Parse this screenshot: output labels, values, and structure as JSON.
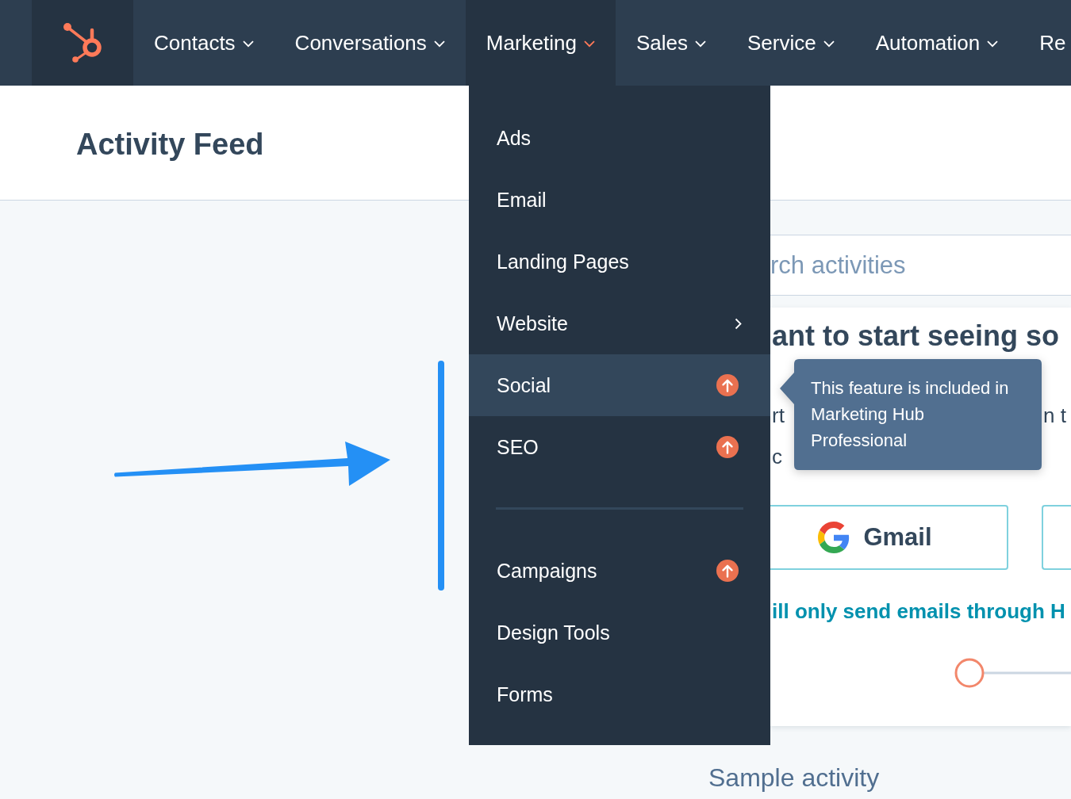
{
  "top_nav": {
    "items": [
      {
        "label": "Contacts",
        "caret": true,
        "selected": false
      },
      {
        "label": "Conversations",
        "caret": true,
        "selected": false
      },
      {
        "label": "Marketing",
        "caret": true,
        "selected": true
      },
      {
        "label": "Sales",
        "caret": true,
        "selected": false
      },
      {
        "label": "Service",
        "caret": true,
        "selected": false
      },
      {
        "label": "Automation",
        "caret": true,
        "selected": false
      },
      {
        "label": "Re",
        "caret": false,
        "selected": false
      }
    ]
  },
  "page_header": {
    "title": "Activity Feed"
  },
  "marketing_menu": {
    "sections": [
      {
        "items": [
          {
            "label": "Ads",
            "kind": "link",
            "selected": false
          },
          {
            "label": "Email",
            "kind": "link",
            "selected": false
          },
          {
            "label": "Landing Pages",
            "kind": "link",
            "selected": false
          },
          {
            "label": "Website",
            "kind": "submenu",
            "selected": false
          },
          {
            "label": "Social",
            "kind": "upgrade",
            "selected": true
          },
          {
            "label": "SEO",
            "kind": "upgrade",
            "selected": false
          }
        ]
      },
      {
        "items": [
          {
            "label": "Campaigns",
            "kind": "upgrade",
            "selected": false
          },
          {
            "label": "Design Tools",
            "kind": "link",
            "selected": false
          },
          {
            "label": "Forms",
            "kind": "link",
            "selected": false
          }
        ]
      }
    ]
  },
  "tooltip": {
    "text": "This feature is included in Marketing Hub Professional"
  },
  "search": {
    "placeholder": "rch activities"
  },
  "connect_card": {
    "heading": "ant to start seeing so",
    "body_lines": [
      {
        "left": "rt",
        "right": "n t"
      },
      {
        "left": "c"
      }
    ],
    "gmail_button": {
      "label": "Gmail"
    },
    "link": "ill only send emails through H"
  },
  "sample_section": {
    "title": "Sample activity"
  }
}
